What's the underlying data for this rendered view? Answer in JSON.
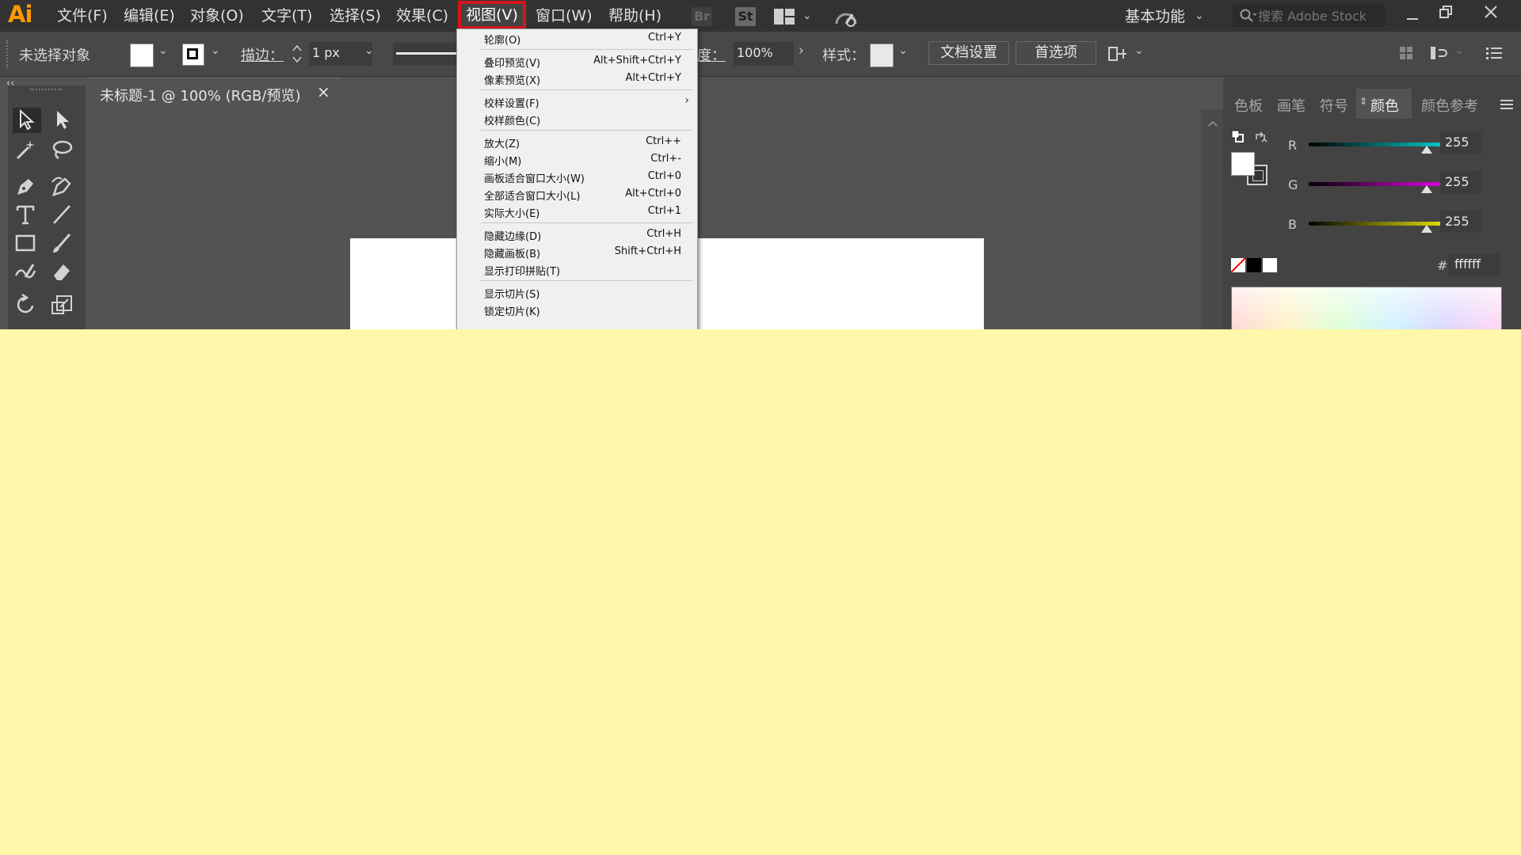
{
  "menubar": {
    "logo": "Ai",
    "items": [
      "文件(F)",
      "编辑(E)",
      "对象(O)",
      "文字(T)",
      "选择(S)",
      "效果(C)",
      "视图(V)",
      "窗口(W)",
      "帮助(H)"
    ],
    "bridge": "Br",
    "stock": "St",
    "workspace": "基本功能",
    "search_placeholder": "搜索 Adobe Stock"
  },
  "controlbar": {
    "selection_status": "未选择对象",
    "stroke_label": "描边：",
    "stroke_value": "1 px",
    "opacity_label": "度：",
    "opacity_value": "100%",
    "style_label": "样式：",
    "doc_setup_button": "文档设置",
    "preferences_button": "首选项"
  },
  "document": {
    "tab_title": "未标题-1 @ 100% (RGB/预览)",
    "close_glyph": "×"
  },
  "color_panel": {
    "tabs": [
      "色板",
      "画笔",
      "符号",
      "颜色",
      "颜色参考"
    ],
    "active_tab": "颜色",
    "channels": [
      {
        "label": "R",
        "value": "255",
        "color": "#00e5e5"
      },
      {
        "label": "G",
        "value": "255",
        "color": "#ff00ff"
      },
      {
        "label": "B",
        "value": "255",
        "color": "#ffff00"
      }
    ],
    "hash": "#",
    "hex_value": "ffffff"
  },
  "view_menu": {
    "groups": [
      [
        {
          "label": "轮廓(O)",
          "shortcut": "Ctrl+Y"
        }
      ],
      [
        {
          "label": "叠印预览(V)",
          "shortcut": "Alt+Shift+Ctrl+Y"
        },
        {
          "label": "像素预览(X)",
          "shortcut": "Alt+Ctrl+Y"
        }
      ],
      [
        {
          "label": "校样设置(F)",
          "shortcut": "",
          "submenu": true
        },
        {
          "label": "校样颜色(C)",
          "shortcut": ""
        }
      ],
      [
        {
          "label": "放大(Z)",
          "shortcut": "Ctrl++"
        },
        {
          "label": "缩小(M)",
          "shortcut": "Ctrl+-"
        },
        {
          "label": "画板适合窗口大小(W)",
          "shortcut": "Ctrl+0"
        },
        {
          "label": "全部适合窗口大小(L)",
          "shortcut": "Alt+Ctrl+0"
        },
        {
          "label": "实际大小(E)",
          "shortcut": "Ctrl+1"
        }
      ],
      [
        {
          "label": "隐藏边缘(D)",
          "shortcut": "Ctrl+H"
        },
        {
          "label": "隐藏画板(B)",
          "shortcut": "Shift+Ctrl+H"
        },
        {
          "label": "显示打印拼贴(T)",
          "shortcut": ""
        }
      ],
      [
        {
          "label": "显示切片(S)",
          "shortcut": ""
        },
        {
          "label": "锁定切片(K)",
          "shortcut": ""
        }
      ]
    ],
    "submenu_glyph": "›"
  }
}
